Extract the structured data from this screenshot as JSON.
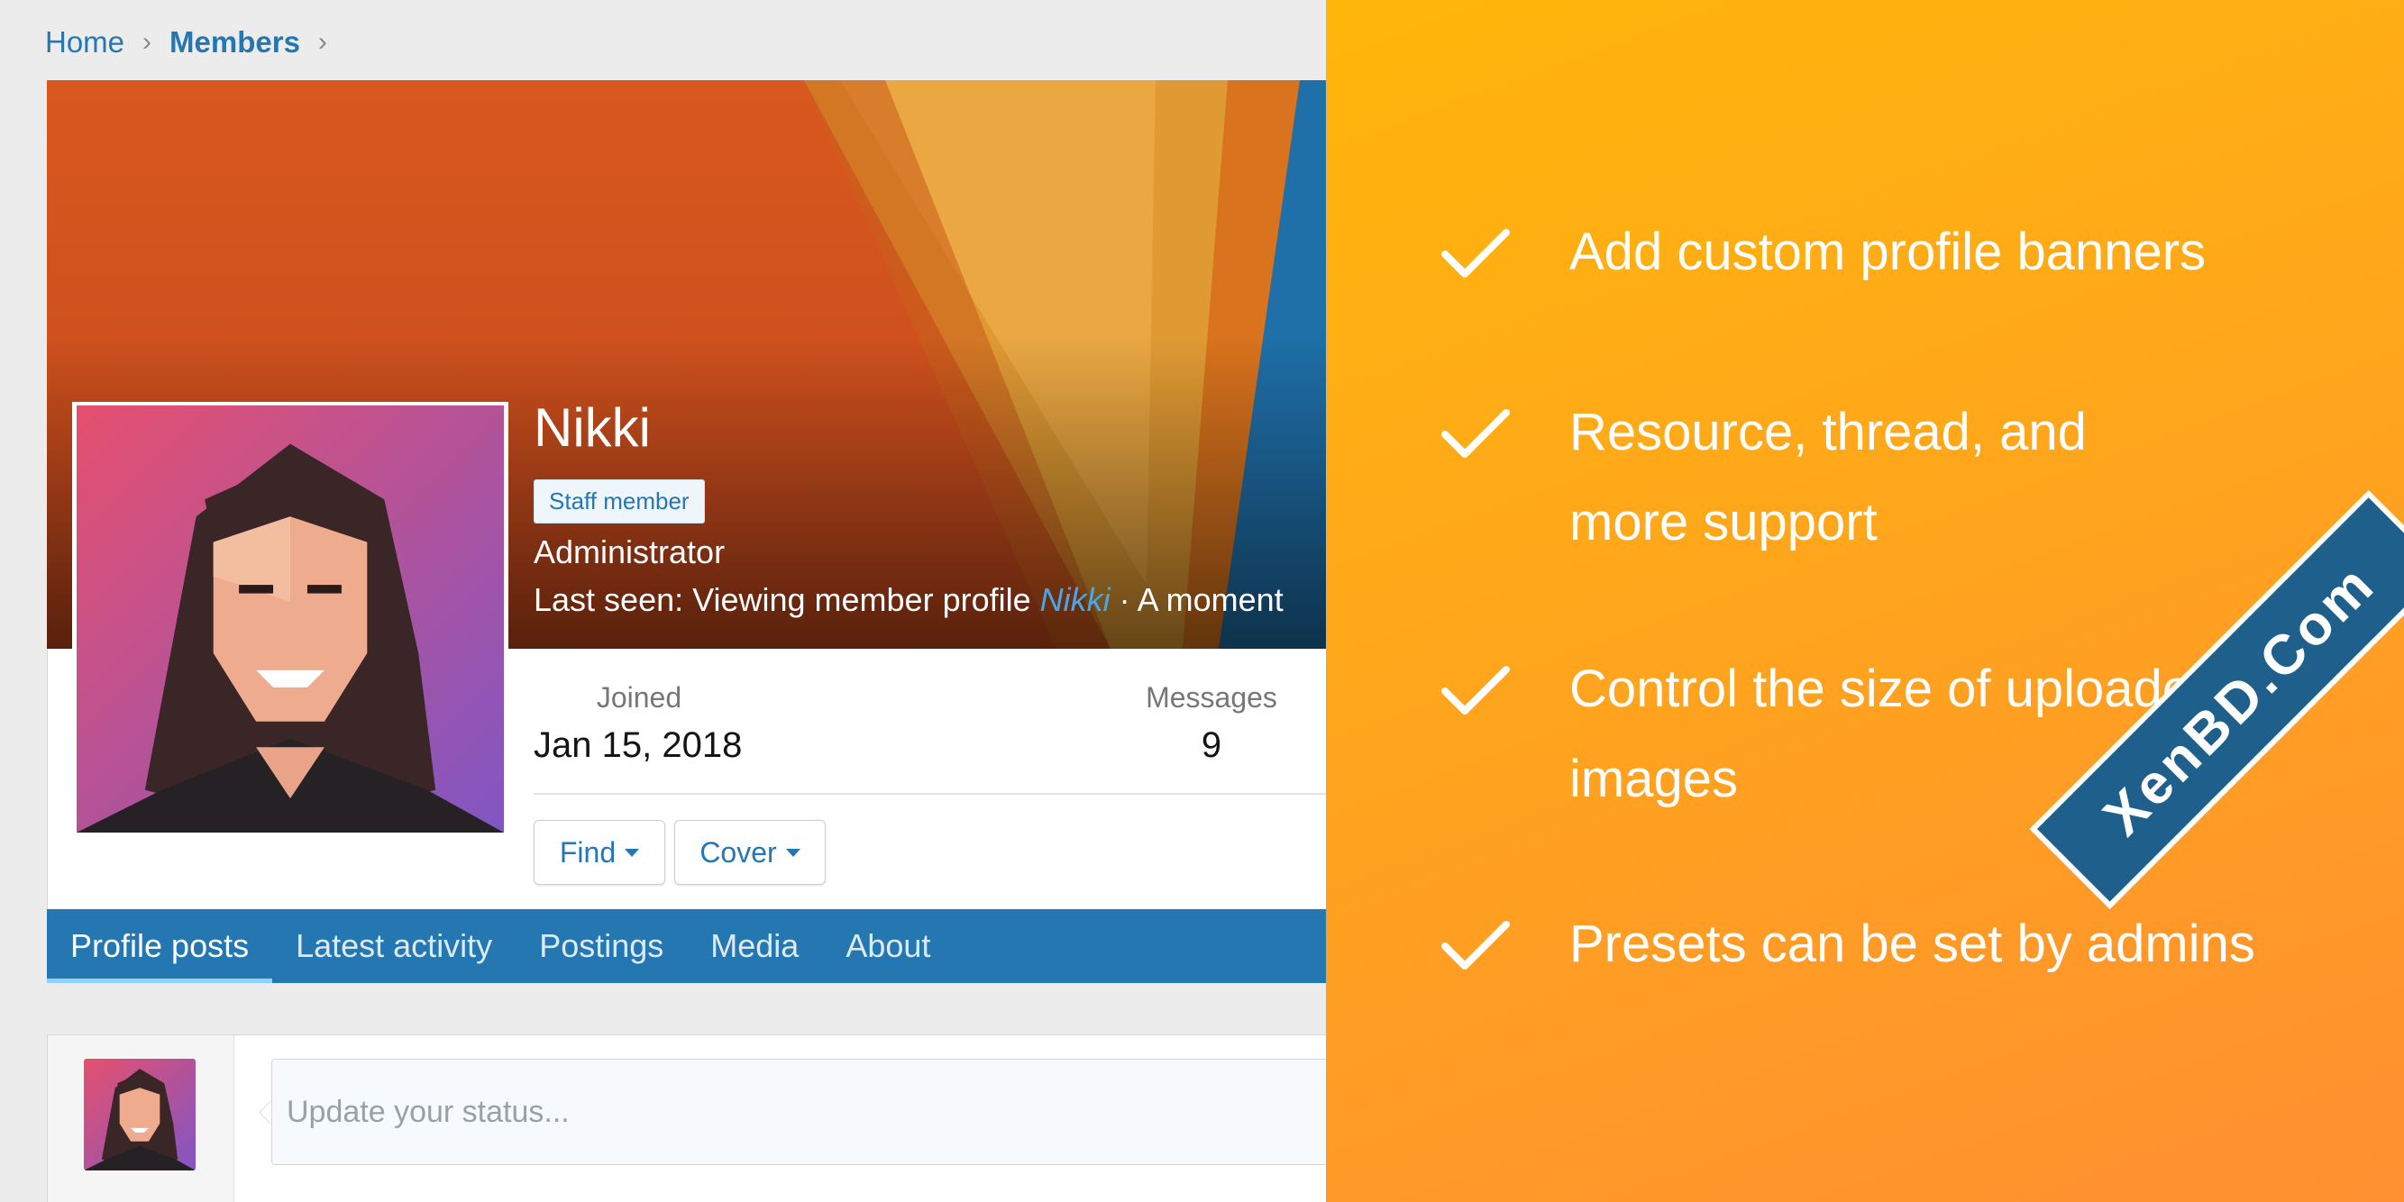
{
  "breadcrumb": {
    "home": "Home",
    "members": "Members",
    "separator": "›"
  },
  "profile": {
    "name": "Nikki",
    "badge": "Staff member",
    "role": "Administrator",
    "last_seen_prefix": "Last seen: Viewing member profile ",
    "last_seen_link": "Nikki",
    "last_seen_suffix": " · A moment"
  },
  "stats": {
    "joined_label": "Joined",
    "joined_value": "Jan 15, 2018",
    "messages_label": "Messages",
    "messages_value": "9"
  },
  "buttons": {
    "find": "Find",
    "cover": "Cover"
  },
  "tabs": [
    {
      "label": "Profile posts",
      "active": true
    },
    {
      "label": "Latest activity"
    },
    {
      "label": "Postings"
    },
    {
      "label": "Media"
    },
    {
      "label": "About"
    }
  ],
  "status": {
    "placeholder": "Update your status..."
  },
  "features": [
    "Add custom profile banners",
    "Resource, thread, and more support",
    "Control the size of uploaded images",
    "Presets can be set by admins"
  ],
  "watermark": "XenBD.Com",
  "colors": {
    "accent": "#2577b1",
    "panel_start": "#ffb60a",
    "panel_end": "#ff8f31",
    "watermark": "#1f5f8b"
  },
  "icons": {
    "separator": "chevron-right-icon",
    "caret": "caret-down-icon",
    "feature": "check-icon"
  }
}
